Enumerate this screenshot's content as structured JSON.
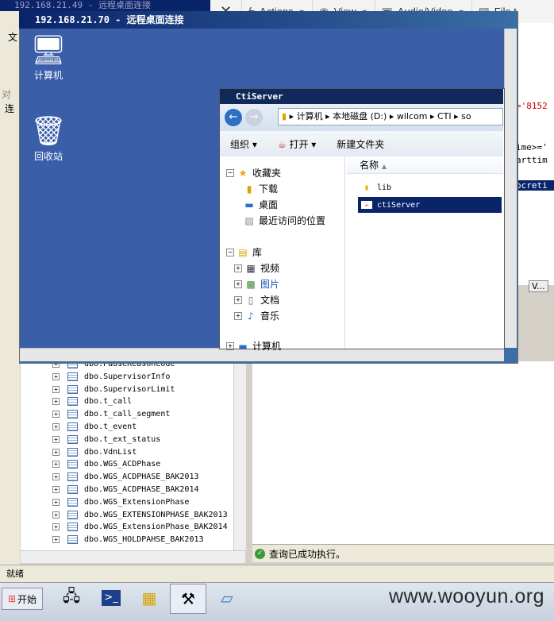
{
  "outer_window": {
    "title": "192.168.21.49 - 远程桌面连接"
  },
  "viewer_toolbar": {
    "close": "✕",
    "actions": "Actions",
    "view": "View",
    "audio_video": "Audio/Video",
    "file": "File t"
  },
  "ssms": {
    "left_fragments": [
      "文",
      "连",
      "对"
    ],
    "query_fragments": [
      "='8152",
      "ime>='",
      "arttim",
      "ocreti"
    ],
    "tab_fragment": "V...",
    "tree_items": [
      "dbo.PauseReasonCode",
      "dbo.SupervisorInfo",
      "dbo.SupervisorLimit",
      "dbo.t_call",
      "dbo.t_call_segment",
      "dbo.t_event",
      "dbo.t_ext_status",
      "dbo.VdnList",
      "dbo.WGS_ACDPhase",
      "dbo.WGS_ACDPHASE_BAK2013",
      "dbo.WGS_ACDPHASE_BAK2014",
      "dbo.WGS_ExtensionPhase",
      "dbo.WGS_EXTENSIONPHASE_BAK2013",
      "dbo.WGS_ExtensionPhase_BAK2014",
      "dbo.WGS_HOLDPAHSE_BAK2013"
    ],
    "message": "查询已成功执行。",
    "status": "就绪"
  },
  "rdp_window": {
    "title": "192.168.21.70 - 远程桌面连接",
    "desktop_icons": [
      {
        "label": "计算机",
        "icon": "computer-icon"
      },
      {
        "label": "回收站",
        "icon": "recycle-bin-icon"
      }
    ]
  },
  "explorer": {
    "title": "CtiServer",
    "address": "▸ 计算机 ▸ 本地磁盘 (D:) ▸ wilcom ▸ CTI ▸ so",
    "commands": {
      "organize": "组织 ▾",
      "open": "打开",
      "new_folder": "新建文件夹"
    },
    "nav": {
      "favorites": "收藏夹",
      "favorites_items": [
        "下载",
        "桌面",
        "最近访问的位置"
      ],
      "libraries": "库",
      "library_items": [
        "视频",
        "图片",
        "文档",
        "音乐"
      ],
      "computer": "计算机"
    },
    "column_name": "名称",
    "files": [
      {
        "name": "lib",
        "type": "folder",
        "selected": false
      },
      {
        "name": "ctiServer",
        "type": "file",
        "selected": true
      }
    ]
  },
  "taskbar": {
    "start": "开始"
  },
  "watermark": "www.wooyun.org",
  "colors": {
    "selection": "#0a246a",
    "desktop": "#3a5fa8",
    "title_bar": "#0a246a"
  }
}
